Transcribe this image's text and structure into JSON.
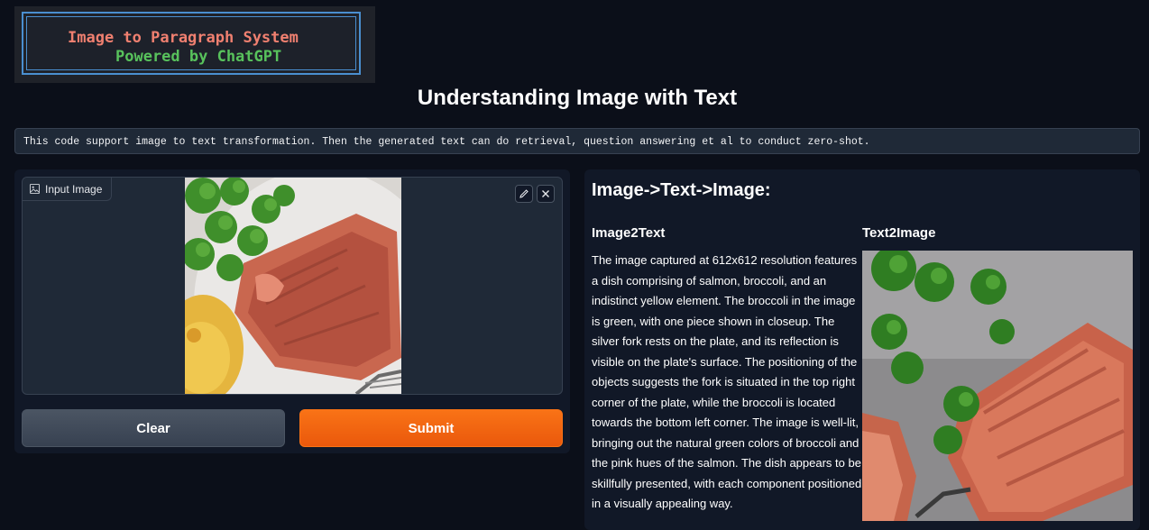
{
  "logo": {
    "line1": "Image to Paragraph System",
    "line2": "Powered by ChatGPT"
  },
  "page_title": "Understanding Image with Text",
  "description": "This code support image to text transformation. Then the generated text can do retrieval, question answering et al to conduct zero-shot.",
  "input_panel": {
    "label": "Input Image",
    "icons": [
      "image-icon",
      "edit-icon",
      "close-icon"
    ],
    "clear_label": "Clear",
    "submit_label": "Submit"
  },
  "output_panel": {
    "title": "Image->Text->Image:",
    "image2text_title": "Image2Text",
    "text2image_title": "Text2Image",
    "paragraph": "The image captured at 612x612 resolution features a dish comprising of salmon, broccoli, and an indistinct yellow element. The broccoli in the image is green, with one piece shown in closeup. The silver fork rests on the plate, and its reflection is visible on the plate's surface. The positioning of the objects suggests the fork is situated in the top right corner of the plate, while the broccoli is located towards the bottom left corner. The image is well-lit, bringing out the natural green colors of broccoli and the pink hues of the salmon. The dish appears to be skillfully presented, with each component positioned in a visually appealing way."
  },
  "colors": {
    "background": "#0b0f19",
    "panel": "#111827",
    "accent": "#f97316",
    "logo_red": "#f08070",
    "logo_green": "#58c25c"
  }
}
